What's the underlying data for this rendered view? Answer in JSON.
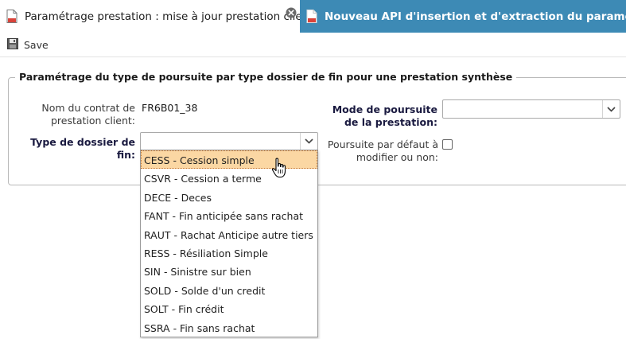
{
  "tabs": [
    {
      "label": "Paramétrage prestation : mise à jour prestation client",
      "active": true
    },
    {
      "label": "Nouveau API d'insertion et d'extraction du paramétrage du",
      "active": false
    }
  ],
  "toolbar": {
    "save_label": "Save"
  },
  "section": {
    "legend": "Paramétrage du type de poursuite par type dossier de fin pour une prestation synthèse",
    "contract_label_1": "Nom du contrat de",
    "contract_label_2": "prestation client:",
    "contract_value": "FR6B01_38",
    "mode_label_1": "Mode de poursuite",
    "mode_label_2": "de la prestation:",
    "mode_value": "",
    "type_label_1": "Type de dossier de",
    "type_label_2": "fin:",
    "type_value": "",
    "default_label_1": "Poursuite par défaut à",
    "default_label_2": "modifier ou non:"
  },
  "dropdown": {
    "highlighted_index": 0,
    "options": [
      "CESS - Cession simple",
      "CSVR - Cession a terme",
      "DECE - Deces",
      "FANT - Fin anticipée sans rachat",
      "RAUT - Rachat Anticipe autre tiers",
      "RESS - Résiliation Simple",
      "SIN - Sinistre sur bien",
      "SOLD - Solde d'un credit",
      "SOLT - Fin crédit",
      "SSRA - Fin sans rachat"
    ]
  },
  "colors": {
    "active_tab_bg": "#ffffff",
    "inactive_tab_bg": "#3d8ab5",
    "highlight_bg": "#fbd7a3",
    "highlight_border": "#c6762e",
    "label_bold": "#1a1a40"
  },
  "icons": {
    "tab_doc": "document-icon",
    "tab_close": "close-icon",
    "save": "floppy-disk-icon",
    "select_arrow": "chevron-down-icon",
    "cursor": "hand-pointer-icon"
  }
}
